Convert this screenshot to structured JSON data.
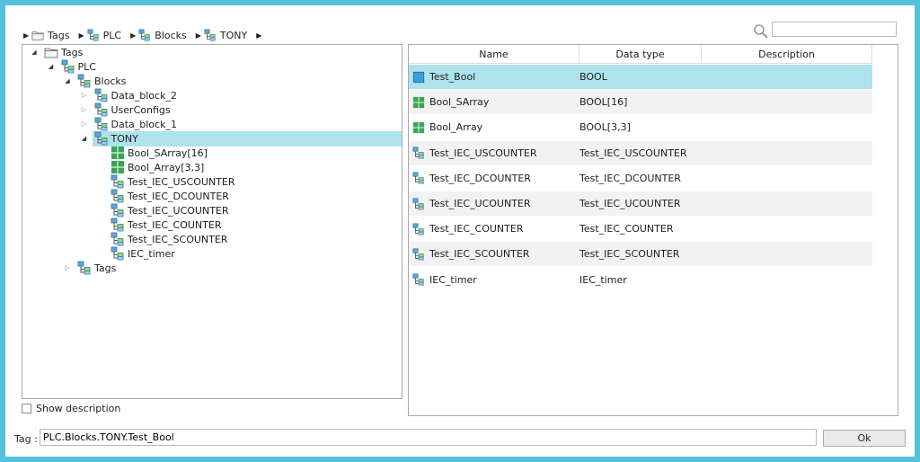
{
  "breadcrumb": [
    {
      "label": "Tags",
      "icon": "folder-icon"
    },
    {
      "label": "PLC",
      "icon": "structure-icon"
    },
    {
      "label": "Blocks",
      "icon": "structure-icon"
    },
    {
      "label": "TONY",
      "icon": "structure-icon"
    }
  ],
  "search": {
    "value": "",
    "placeholder": ""
  },
  "tree": {
    "items": [
      {
        "label": "Tags",
        "level": 0,
        "expander": "expanded",
        "icon": "folder-icon"
      },
      {
        "label": "PLC",
        "level": 1,
        "expander": "expanded",
        "icon": "structure-icon"
      },
      {
        "label": "Blocks",
        "level": 2,
        "expander": "expanded",
        "icon": "structure-icon"
      },
      {
        "label": "Data_block_2",
        "level": 3,
        "expander": "collapsed",
        "icon": "structure-icon"
      },
      {
        "label": "UserConfigs",
        "level": 3,
        "expander": "collapsed",
        "icon": "structure-icon"
      },
      {
        "label": "Data_block_1",
        "level": 3,
        "expander": "collapsed",
        "icon": "structure-icon"
      },
      {
        "label": "TONY",
        "level": 3,
        "expander": "expanded",
        "icon": "structure-icon",
        "selected": true
      },
      {
        "label": "Bool_SArray[16]",
        "level": 4,
        "expander": "none",
        "icon": "array-icon"
      },
      {
        "label": "Bool_Array[3,3]",
        "level": 4,
        "expander": "none",
        "icon": "array-icon"
      },
      {
        "label": "Test_IEC_USCOUNTER",
        "level": 4,
        "expander": "none",
        "icon": "structure-icon"
      },
      {
        "label": "Test_IEC_DCOUNTER",
        "level": 4,
        "expander": "none",
        "icon": "structure-icon"
      },
      {
        "label": "Test_IEC_UCOUNTER",
        "level": 4,
        "expander": "none",
        "icon": "structure-icon"
      },
      {
        "label": "Test_IEC_COUNTER",
        "level": 4,
        "expander": "none",
        "icon": "structure-icon"
      },
      {
        "label": "Test_IEC_SCOUNTER",
        "level": 4,
        "expander": "none",
        "icon": "structure-icon"
      },
      {
        "label": "IEC_timer",
        "level": 4,
        "expander": "none",
        "icon": "structure-icon"
      },
      {
        "label": "Tags",
        "level": 2,
        "expander": "collapsed",
        "icon": "structure-icon"
      }
    ]
  },
  "show_description": {
    "label": "Show description",
    "checked": false
  },
  "table": {
    "columns": [
      "Name",
      "Data type",
      "Description"
    ],
    "rows": [
      {
        "name": "Test_Bool",
        "type": "BOOL",
        "description": "",
        "icon": "bool-icon",
        "selected": true
      },
      {
        "name": "Bool_SArray",
        "type": "BOOL[16]",
        "description": "",
        "icon": "array-icon"
      },
      {
        "name": "Bool_Array",
        "type": "BOOL[3,3]",
        "description": "",
        "icon": "array-icon"
      },
      {
        "name": "Test_IEC_USCOUNTER",
        "type": "Test_IEC_USCOUNTER",
        "description": "",
        "icon": "structure-icon"
      },
      {
        "name": "Test_IEC_DCOUNTER",
        "type": "Test_IEC_DCOUNTER",
        "description": "",
        "icon": "structure-icon"
      },
      {
        "name": "Test_IEC_UCOUNTER",
        "type": "Test_IEC_UCOUNTER",
        "description": "",
        "icon": "structure-icon"
      },
      {
        "name": "Test_IEC_COUNTER",
        "type": "Test_IEC_COUNTER",
        "description": "",
        "icon": "structure-icon"
      },
      {
        "name": "Test_IEC_SCOUNTER",
        "type": "Test_IEC_SCOUNTER",
        "description": "",
        "icon": "structure-icon"
      },
      {
        "name": "IEC_timer",
        "type": "IEC_timer",
        "description": "",
        "icon": "structure-icon"
      }
    ]
  },
  "footer": {
    "tag_label": "Tag :",
    "tag_value": "PLC.Blocks.TONY.Test_Bool",
    "ok_label": "Ok"
  },
  "colors": {
    "frame": "#55c2dd",
    "selection": "#aee2ed",
    "alt_row": "#f2f2f2"
  }
}
